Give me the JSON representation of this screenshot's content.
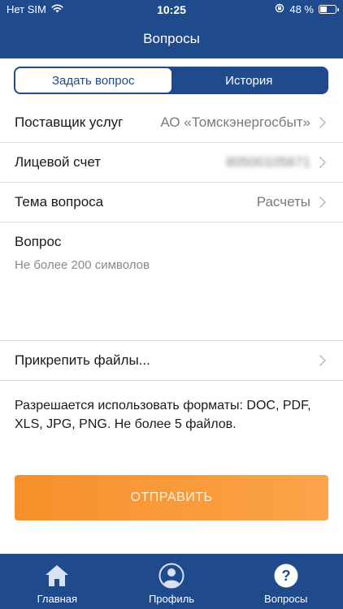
{
  "status_bar": {
    "carrier": "Нет SIM",
    "time": "10:25",
    "battery": "48 %",
    "battery_level": 0.48
  },
  "header": {
    "title": "Вопросы"
  },
  "tabs": [
    {
      "label": "Задать вопрос",
      "active": true
    },
    {
      "label": "История",
      "active": false
    }
  ],
  "form": {
    "provider": {
      "label": "Поставщик услуг",
      "value": "АО «Томскэнергосбыт»"
    },
    "account": {
      "label": "Лицевой счет",
      "value": "80500105671"
    },
    "topic": {
      "label": "Тема вопроса",
      "value": "Расчеты"
    },
    "question": {
      "label": "Вопрос",
      "placeholder": "Не более 200 символов",
      "value": ""
    },
    "attach": {
      "label": "Прикрепить файлы..."
    },
    "info": "Разрешается использовать форматы: DOC, PDF, XLS, JPG, PNG. Не более 5 файлов.",
    "submit_label": "ОТПРАВИТЬ"
  },
  "tabbar": [
    {
      "label": "Главная",
      "icon": "home-icon"
    },
    {
      "label": "Профиль",
      "icon": "profile-icon"
    },
    {
      "label": "Вопросы",
      "icon": "question-icon"
    }
  ],
  "colors": {
    "primary": "#1f4a8c",
    "accent": "#f7902a"
  }
}
